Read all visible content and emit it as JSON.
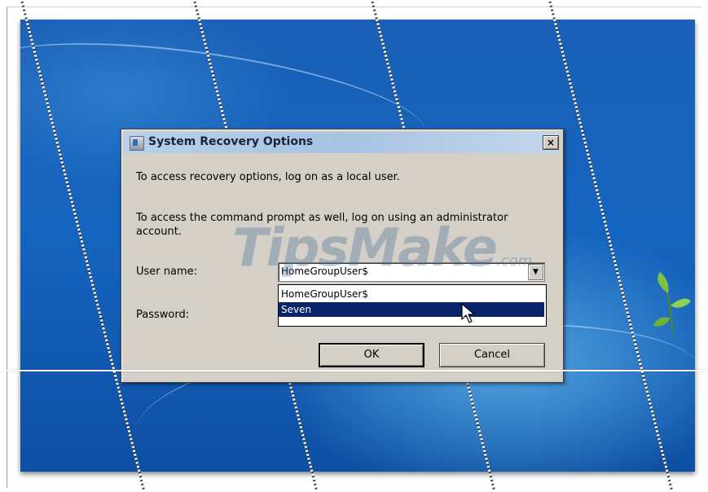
{
  "dialog": {
    "title": "System Recovery Options",
    "close_label": "×",
    "instruction_1": "To access recovery options, log on as a local user.",
    "instruction_2": "To access the command prompt as well, log on using an administrator account.",
    "user_name_label": "User name:",
    "password_label": "Password:",
    "user_name_value": "HomeGroupUser$",
    "dropdown_arrow": "▼",
    "user_options": [
      {
        "label": "HomeGroupUser$",
        "selected": false
      },
      {
        "label": "Seven",
        "selected": true
      }
    ],
    "ok_label": "OK",
    "cancel_label": "Cancel"
  },
  "watermark": {
    "text": "TipsMake",
    "suffix": ".com"
  },
  "icons": {
    "title": "recovery-app-icon",
    "close": "close-icon",
    "dropdown": "chevron-down-icon",
    "cursor": "mouse-pointer-icon",
    "leaf": "plant-leaf-icon"
  },
  "colors": {
    "desktop": "#1565c0",
    "dialog_face": "#d4d0c8",
    "selection": "#0a246a"
  }
}
